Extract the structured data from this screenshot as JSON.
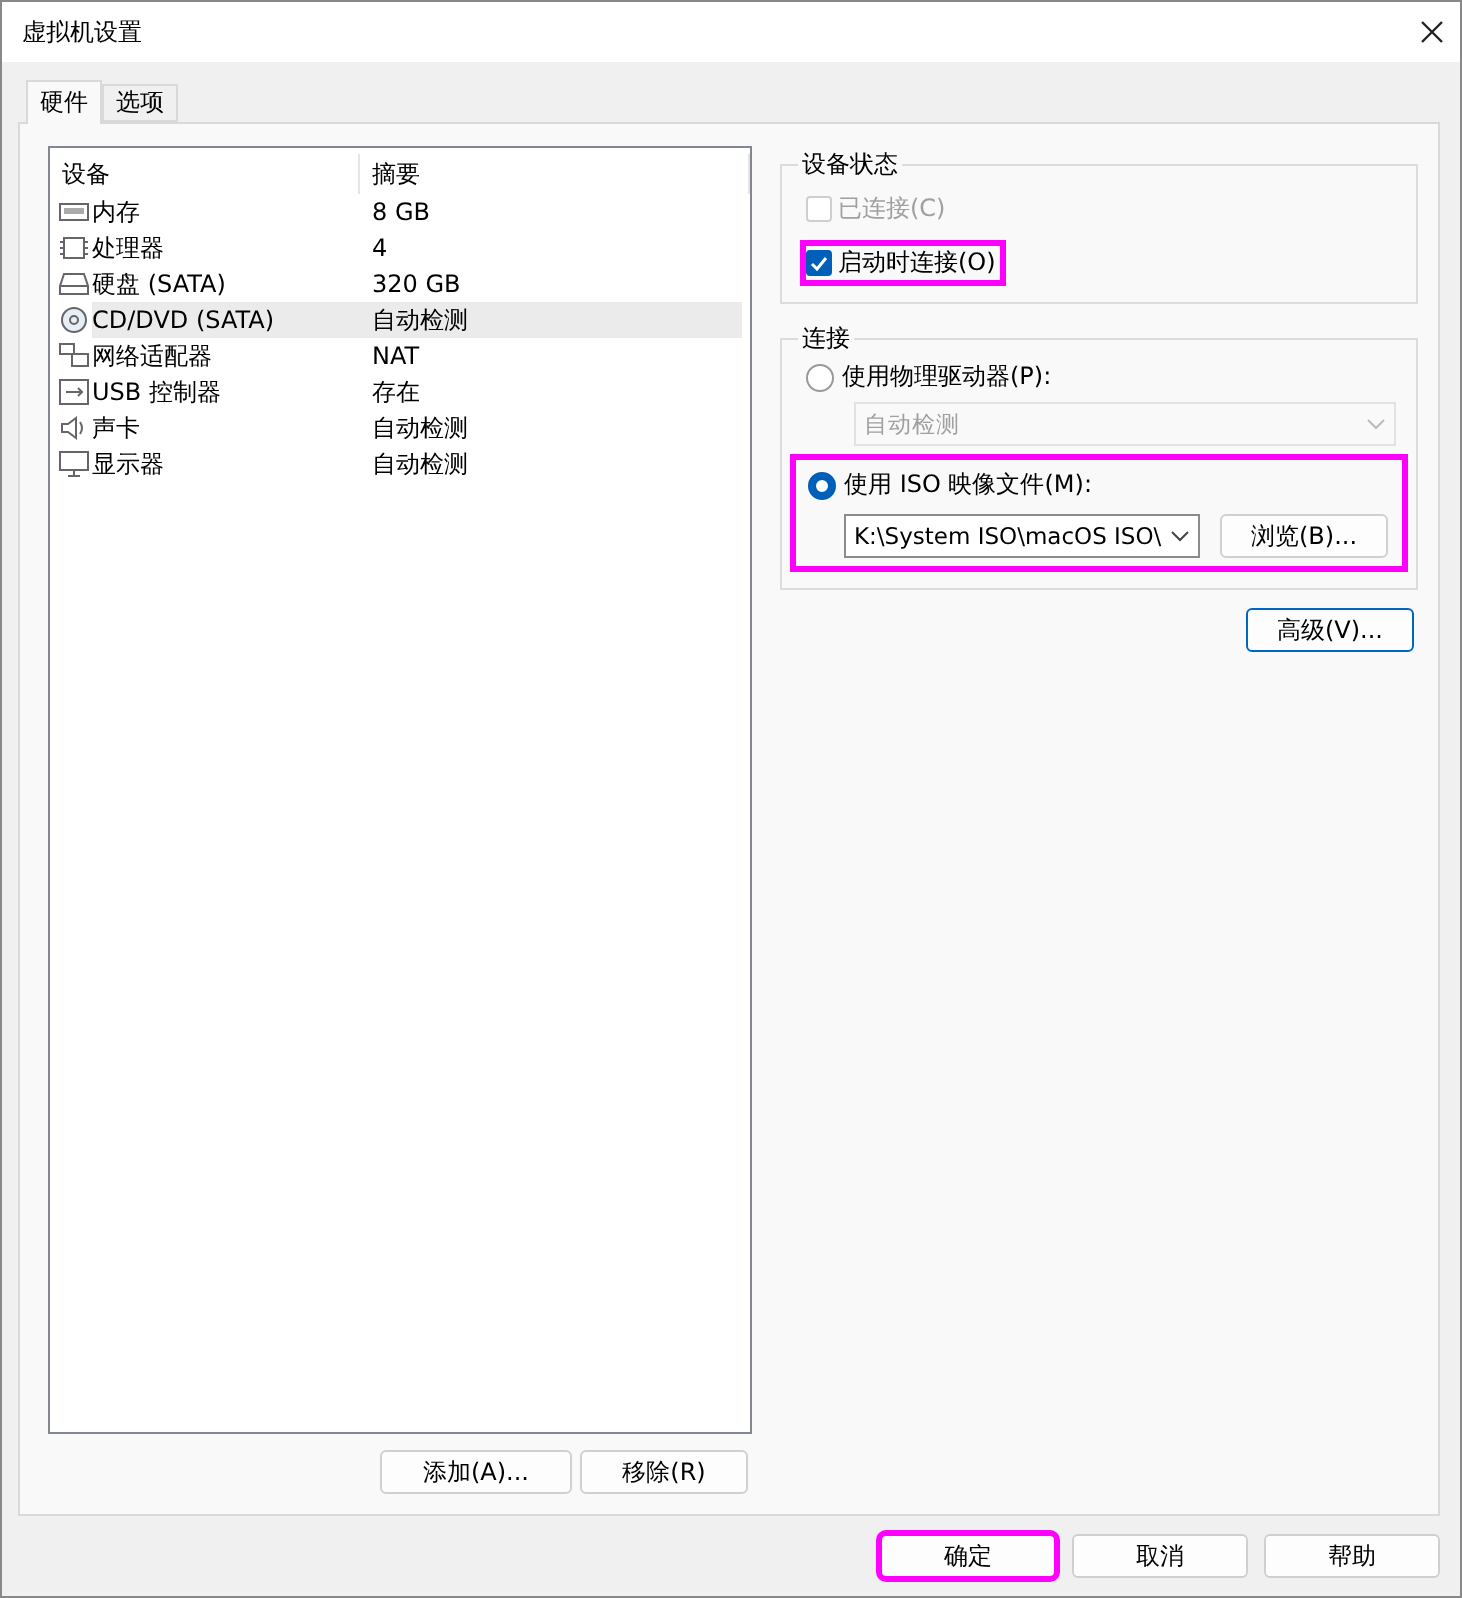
{
  "window": {
    "title": "虚拟机设置"
  },
  "tabs": [
    {
      "label": "硬件",
      "selected": true
    },
    {
      "label": "选项",
      "selected": false
    }
  ],
  "device_table": {
    "columns": [
      "设备",
      "摘要"
    ],
    "rows": [
      {
        "kind": "memory",
        "device": "内存",
        "summary": "8 GB",
        "selected": false
      },
      {
        "kind": "cpu",
        "device": "处理器",
        "summary": "4",
        "selected": false
      },
      {
        "kind": "disk",
        "device": "硬盘 (SATA)",
        "summary": "320 GB",
        "selected": false
      },
      {
        "kind": "cd",
        "device": "CD/DVD (SATA)",
        "summary": "自动检测",
        "selected": true
      },
      {
        "kind": "network",
        "device": "网络适配器",
        "summary": "NAT",
        "selected": false
      },
      {
        "kind": "usb",
        "device": "USB 控制器",
        "summary": "存在",
        "selected": false
      },
      {
        "kind": "sound",
        "device": "声卡",
        "summary": "自动检测",
        "selected": false
      },
      {
        "kind": "display",
        "device": "显示器",
        "summary": "自动检测",
        "selected": false
      }
    ]
  },
  "list_buttons": [
    "添加(A)...",
    "移除(R)"
  ],
  "device_status": {
    "title": "设备状态",
    "options": [
      {
        "label": "已连接(C)",
        "checked": false,
        "disabled": true,
        "highlighted": false
      },
      {
        "label": "启动时连接(O)",
        "checked": true,
        "disabled": false,
        "highlighted": true
      }
    ]
  },
  "connection": {
    "title": "连接",
    "physical": {
      "label": "使用物理驱动器(P):",
      "selected": false,
      "drive": "自动检测",
      "disabled": true
    },
    "iso": {
      "label": "使用 ISO 映像文件(M):",
      "selected": true,
      "path": "K:\\System ISO\\macOS ISO\\",
      "browse": "浏览(B)...",
      "highlighted": true
    }
  },
  "advanced_button": "高级(V)...",
  "footer_buttons": [
    {
      "label": "确定",
      "highlighted": true
    },
    {
      "label": "取消",
      "highlighted": false
    },
    {
      "label": "帮助",
      "highlighted": false
    }
  ]
}
